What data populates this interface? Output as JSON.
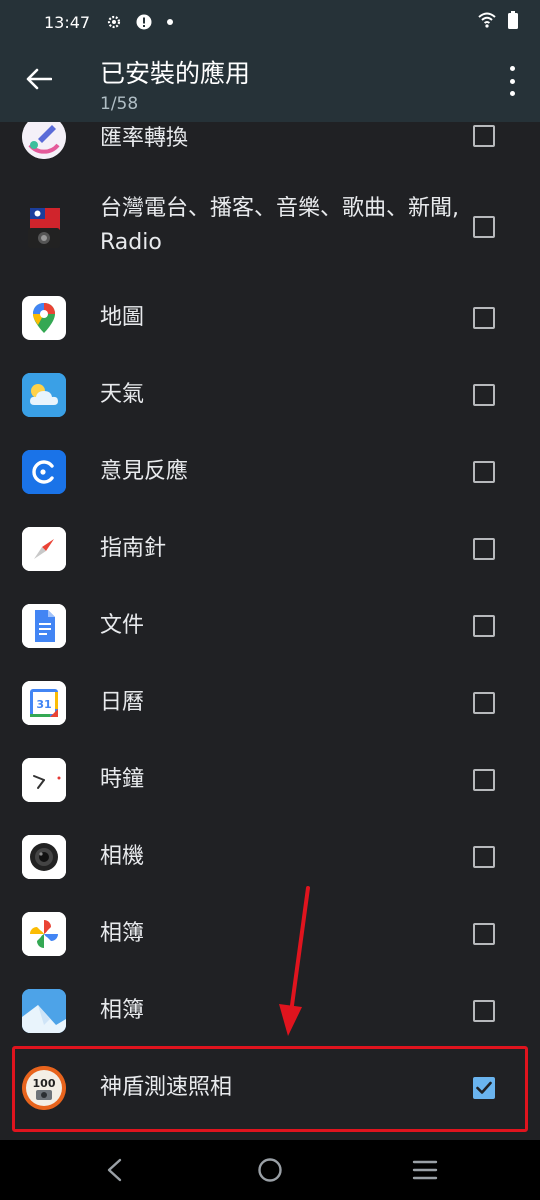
{
  "status": {
    "time": "13:47"
  },
  "header": {
    "title": "已安裝的應用",
    "subtitle": "1/58"
  },
  "apps": [
    {
      "name": "匯率轉換",
      "icon": "rocket-currency-icon",
      "checked": false
    },
    {
      "name": "台灣電台、播客、音樂、歌曲、新聞, Radio",
      "icon": "taiwan-radio-icon",
      "checked": false
    },
    {
      "name": "地圖",
      "icon": "maps-icon",
      "checked": false
    },
    {
      "name": "天氣",
      "icon": "weather-icon",
      "checked": false
    },
    {
      "name": "意見反應",
      "icon": "feedback-icon",
      "checked": false
    },
    {
      "name": "指南針",
      "icon": "compass-icon",
      "checked": false
    },
    {
      "name": "文件",
      "icon": "docs-icon",
      "checked": false
    },
    {
      "name": "日曆",
      "icon": "calendar-icon",
      "checked": false
    },
    {
      "name": "時鐘",
      "icon": "clock-icon",
      "checked": false
    },
    {
      "name": "相機",
      "icon": "camera-icon",
      "checked": false
    },
    {
      "name": "相簿",
      "icon": "google-photos-icon",
      "checked": false
    },
    {
      "name": "相簿",
      "icon": "gallery-icon",
      "checked": false
    },
    {
      "name": "神盾測速照相",
      "icon": "speed-camera-icon",
      "checked": true
    }
  ],
  "calendar_icon_text": "31",
  "speed_icon_text": "100"
}
